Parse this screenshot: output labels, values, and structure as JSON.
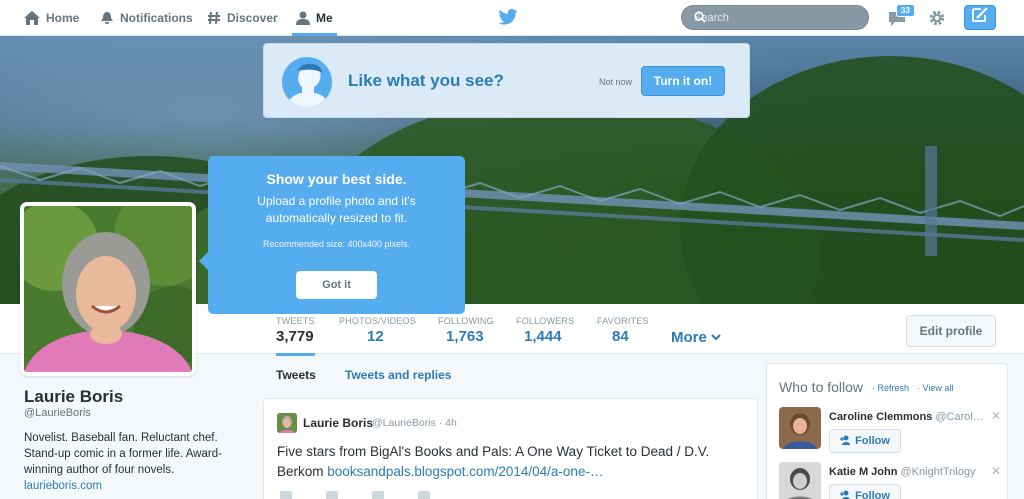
{
  "nav": {
    "items": [
      {
        "label": "Home",
        "icon": "home-icon"
      },
      {
        "label": "Notifications",
        "icon": "bell-icon"
      },
      {
        "label": "Discover",
        "icon": "hashtag-icon"
      },
      {
        "label": "Me",
        "icon": "person-icon",
        "active": true
      }
    ],
    "search_placeholder": "Search",
    "messages_badge": "33",
    "brand_color": "#55acee"
  },
  "promo": {
    "title": "Like what you see?",
    "not_now": "Not now",
    "button": "Turn it on!"
  },
  "tooltip": {
    "title": "Show your best side.",
    "body": "Upload a profile photo and it's automatically resized to fit.",
    "size_note": "Recommended size: 400x400 pixels.",
    "button": "Got it"
  },
  "stats": [
    {
      "label": "TWEETS",
      "value": "3,779"
    },
    {
      "label": "PHOTOS/VIDEOS",
      "value": "12"
    },
    {
      "label": "FOLLOWING",
      "value": "1,763"
    },
    {
      "label": "FOLLOWERS",
      "value": "1,444"
    },
    {
      "label": "FAVORITES",
      "value": "84"
    }
  ],
  "more_label": "More",
  "edit_profile": "Edit profile",
  "profile": {
    "name": "Laurie Boris",
    "handle": "@LaurieBoris",
    "bio": "Novelist. Baseball fan. Reluctant chef. Stand-up comic in a former life. Award-winning author of four novels.",
    "url": "laurieboris.com"
  },
  "tabs": [
    "Tweets",
    "Tweets and replies"
  ],
  "tweet": {
    "name": "Laurie Boris",
    "handle": "@LaurieBoris",
    "time": "4h",
    "text": "Five stars from BigAl's Books and Pals: A One Way Ticket to Dead / D.V. Berkom ",
    "link": "booksandpals.blogspot.com/2014/04/a-one-…"
  },
  "who_to_follow": {
    "title": "Who to follow",
    "refresh": "Refresh",
    "view_all": "View all",
    "follow_label": "Follow",
    "users": [
      {
        "name": "Caroline Clemmons",
        "handle": "@Carol…"
      },
      {
        "name": "Katie M John",
        "handle": "@KnightTrilogy"
      }
    ]
  }
}
